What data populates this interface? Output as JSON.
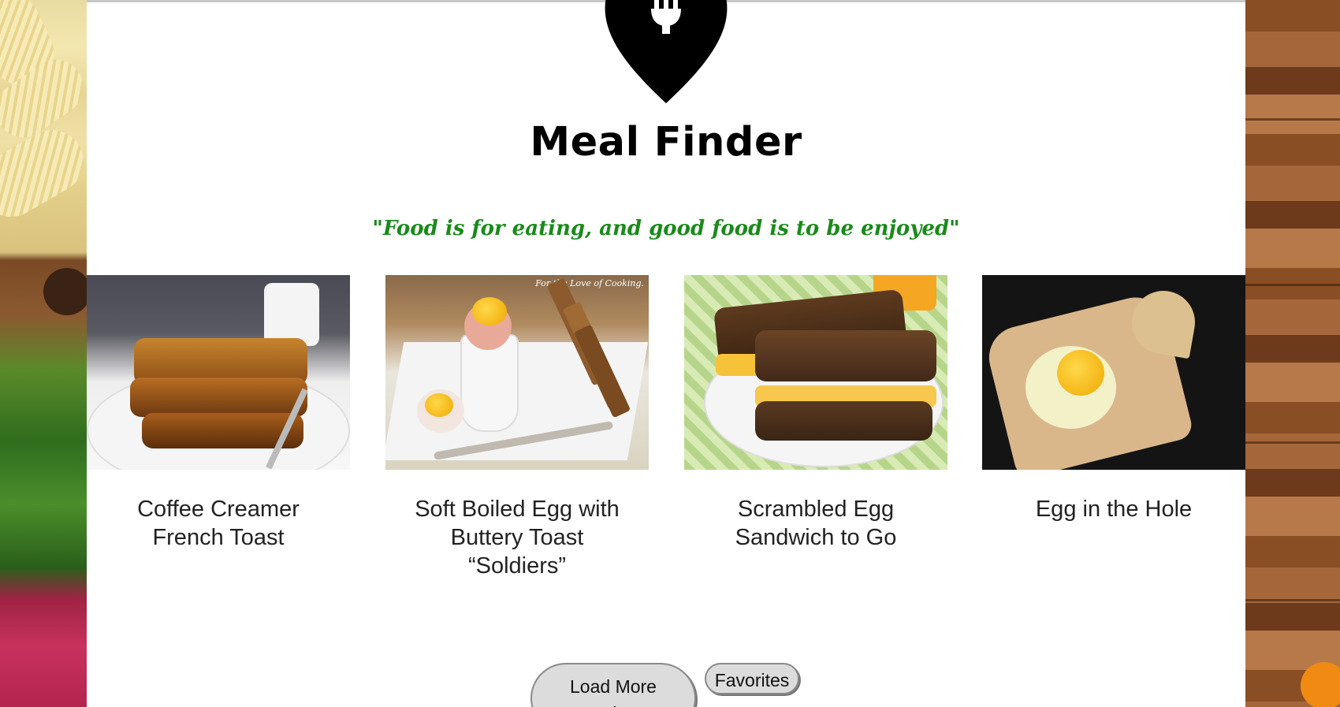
{
  "app": {
    "title": "Meal Finder",
    "quote": "\"Food is for eating, and good food is to be enjoyed\""
  },
  "recipes": [
    {
      "title": "Coffee Creamer French Toast",
      "image": "french-toast-photo"
    },
    {
      "title": "Soft Boiled Egg with Buttery Toast “Soldiers”",
      "image": "soft-boiled-egg-photo",
      "watermark": "For the Love of Cooking."
    },
    {
      "title": "Scrambled Egg Sandwich to Go",
      "image": "egg-sandwich-photo"
    },
    {
      "title": "Egg in the Hole",
      "image": "egg-in-hole-photo"
    }
  ],
  "buttons": {
    "load_more": "Load More Recipes",
    "favorites": "Favorites"
  },
  "colors": {
    "quote": "#1a8a1a",
    "button_bg": "#dcdcdc",
    "title": "#000000"
  },
  "icons": {
    "logo": "location-pin-fork-icon"
  }
}
